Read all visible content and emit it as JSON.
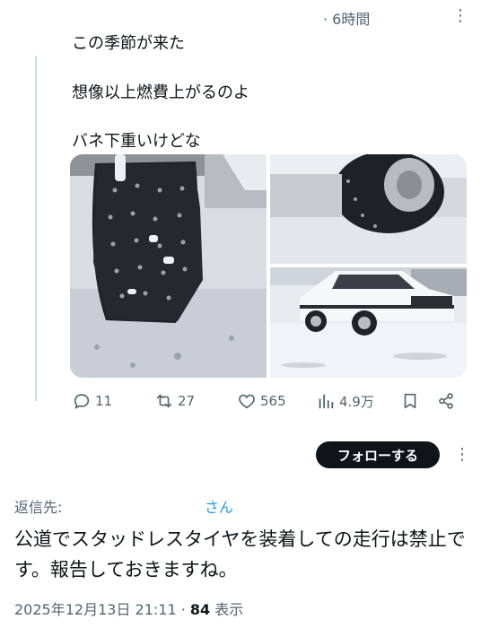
{
  "tweet": {
    "time": "· 6時間",
    "more_icon": "⋮",
    "lines": [
      "この季節が来た",
      "想像以上燃費上がるのよ",
      "バネ下重いけどな"
    ],
    "media": [
      "studded-tire-closeup",
      "tire-on-car-snow",
      "white-sedan-in-snow"
    ]
  },
  "actions": {
    "reply_count": "11",
    "retweet_count": "27",
    "like_count": "565",
    "view_count": "4.9万"
  },
  "follow": {
    "label": "フォローする",
    "more_icon": "⋮"
  },
  "reply": {
    "label": "返信先:",
    "user": "さん",
    "text": "公道でスタッドレスタイヤを装着しての走行は禁止です。報告しておきますね。",
    "date": "2025年12月13日 21:11",
    "separator": " · ",
    "views_number": "84",
    "views_label": " 表示"
  },
  "colors": {
    "text": "#0f1419",
    "muted": "#536471",
    "link": "#1d9bf0",
    "button_bg": "#0f1419",
    "thread_line": "#cfd9de"
  }
}
